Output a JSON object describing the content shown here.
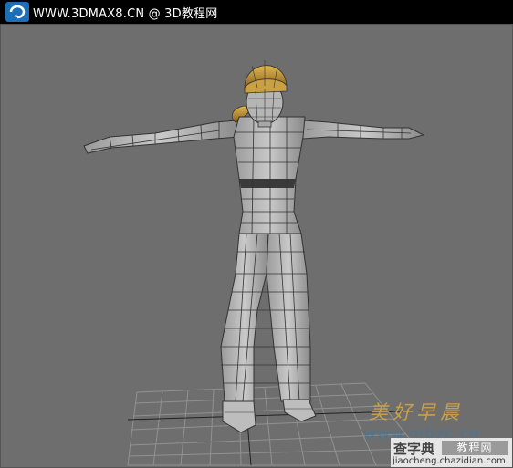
{
  "header": {
    "site_text": "WWW.3DMAX8.CN @ 3D教程网",
    "logo_icon": "swirl-logo-icon"
  },
  "watermark": {
    "chinese": "美好早晨",
    "url": "www.mbzc.cn"
  },
  "badge": {
    "title": "查字典",
    "tag": "教程网",
    "domain": "jiaocheng.chazidian.com"
  },
  "colors": {
    "topbar": "#000000",
    "viewport_bg": "#6e6e6e",
    "mesh": "#b8b8b8",
    "hair": "#c89a3a",
    "watermark_gold": "#d3a548",
    "watermark_blue": "#3a78a8"
  }
}
